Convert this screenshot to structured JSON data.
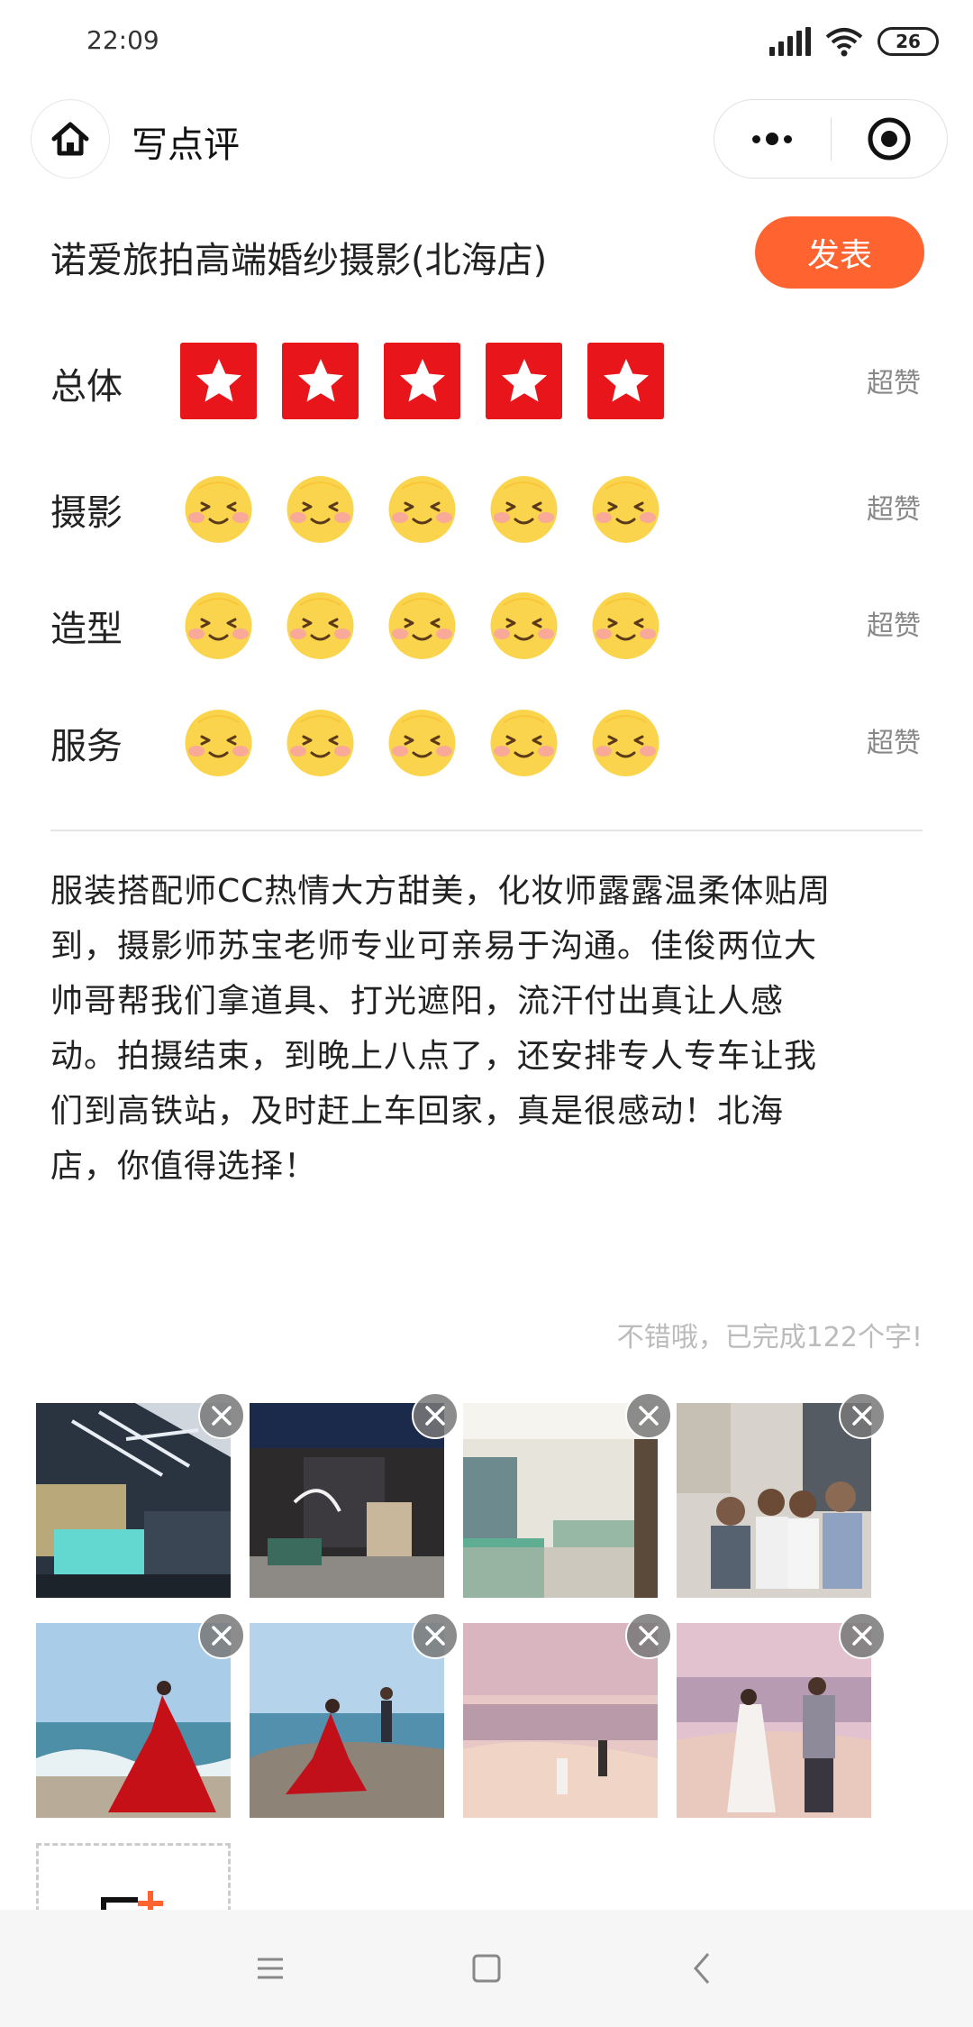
{
  "status_bar": {
    "time": "22:09",
    "battery": "26"
  },
  "header": {
    "title": "写点评"
  },
  "shop": {
    "name": "诺爱旅拍高端婚纱摄影(北海店)",
    "publish_label": "发表"
  },
  "ratings": [
    {
      "label": "总体",
      "type": "star",
      "score": 5,
      "max": 5,
      "desc": "超赞"
    },
    {
      "label": "摄影",
      "type": "face",
      "score": 5,
      "max": 5,
      "desc": "超赞"
    },
    {
      "label": "造型",
      "type": "face",
      "score": 5,
      "max": 5,
      "desc": "超赞"
    },
    {
      "label": "服务",
      "type": "face",
      "score": 5,
      "max": 5,
      "desc": "超赞"
    }
  ],
  "review": {
    "lines": [
      "服装搭配师CC热情大方甜美，化妆师露露温柔体贴周",
      "到，摄影师苏宝老师专业可亲易于沟通。佳俊两位大",
      "帅哥帮我们拿道具、打光遮阳，流汗付出真让人感",
      "动。拍摄结束，到晚上八点了，还安排专人专车让我",
      "们到高铁站，及时赶上车回家，真是很感动！北海",
      "店，你值得选择！"
    ],
    "char_count": "不错哦，已完成122个字!"
  },
  "photos": [
    {
      "kind": "lobby-dark"
    },
    {
      "kind": "shop-entrance"
    },
    {
      "kind": "lounge"
    },
    {
      "kind": "group-people"
    },
    {
      "kind": "beach-red-dress"
    },
    {
      "kind": "rocks-red-dress"
    },
    {
      "kind": "sunset-beach"
    },
    {
      "kind": "couple-walking"
    }
  ],
  "colors": {
    "accent": "#fe6330",
    "star_red": "#e8161a",
    "face_yellow": "#fbd44d"
  },
  "icons": {
    "home": "home-icon",
    "more": "more-dots-icon",
    "close": "target-close-icon",
    "delete": "close-icon",
    "add_photo": "add-photo-icon"
  }
}
